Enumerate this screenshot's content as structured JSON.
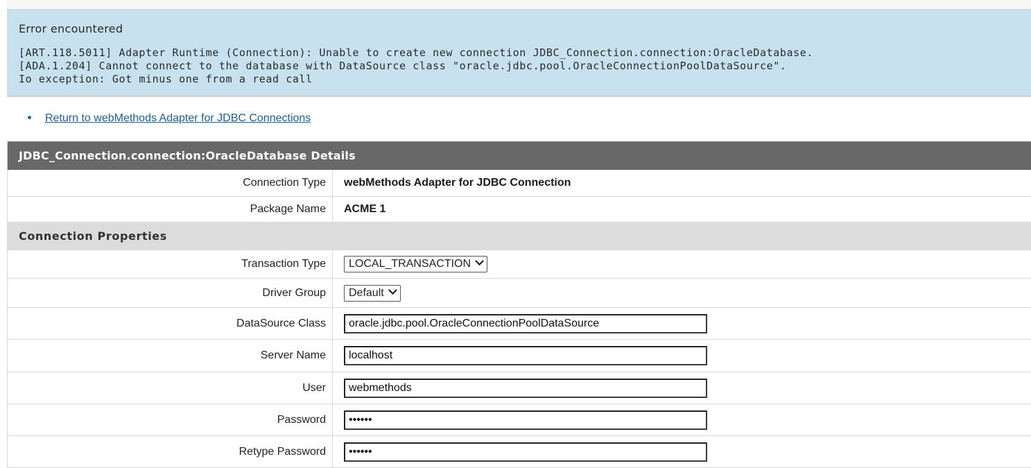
{
  "error": {
    "title": "Error encountered",
    "lines": [
      "[ART.118.5011] Adapter Runtime (Connection): Unable to create new connection JDBC_Connection.connection:OracleDatabase.",
      "[ADA.1.204] Cannot connect to the database with DataSource class \"oracle.jdbc.pool.OracleConnectionPoolDataSource\".",
      "Io exception: Got minus one from a read call"
    ]
  },
  "nav": {
    "return_link": "Return to webMethods Adapter for JDBC Connections"
  },
  "details": {
    "header": "JDBC_Connection.connection:OracleDatabase Details",
    "connection_type_label": "Connection Type",
    "connection_type_value": "webMethods Adapter for JDBC Connection",
    "package_name_label": "Package Name",
    "package_name_value": "ACME 1"
  },
  "properties": {
    "header": "Connection Properties",
    "transaction_type_label": "Transaction Type",
    "transaction_type_value": "LOCAL_TRANSACTION",
    "driver_group_label": "Driver Group",
    "driver_group_value": "Default",
    "datasource_class_label": "DataSource Class",
    "datasource_class_value": "oracle.jdbc.pool.OracleConnectionPoolDataSource",
    "server_name_label": "Server Name",
    "server_name_value": "localhost",
    "user_label": "User",
    "user_value": "webmethods",
    "password_label": "Password",
    "password_value": "aaaaaa",
    "retype_password_label": "Retype Password",
    "retype_password_value": "aaaaaa"
  }
}
